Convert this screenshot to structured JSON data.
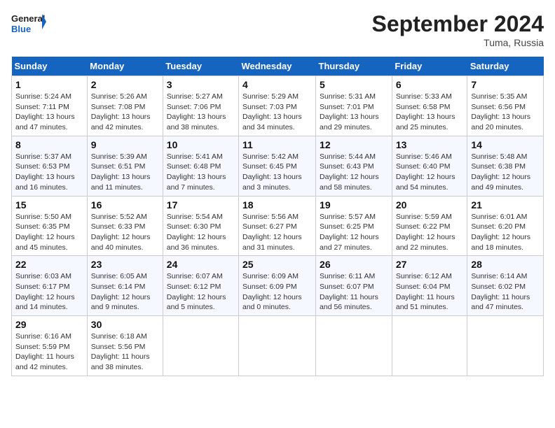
{
  "logo": {
    "line1": "General",
    "line2": "Blue"
  },
  "title": "September 2024",
  "location": "Tuma, Russia",
  "days_of_week": [
    "Sunday",
    "Monday",
    "Tuesday",
    "Wednesday",
    "Thursday",
    "Friday",
    "Saturday"
  ],
  "weeks": [
    [
      {
        "day": 1,
        "rise": "5:24 AM",
        "set": "7:11 PM",
        "hours": "13 hours",
        "mins": "47 minutes"
      },
      {
        "day": 2,
        "rise": "5:26 AM",
        "set": "7:08 PM",
        "hours": "13 hours",
        "mins": "42 minutes"
      },
      {
        "day": 3,
        "rise": "5:27 AM",
        "set": "7:06 PM",
        "hours": "13 hours",
        "mins": "38 minutes"
      },
      {
        "day": 4,
        "rise": "5:29 AM",
        "set": "7:03 PM",
        "hours": "13 hours",
        "mins": "34 minutes"
      },
      {
        "day": 5,
        "rise": "5:31 AM",
        "set": "7:01 PM",
        "hours": "13 hours",
        "mins": "29 minutes"
      },
      {
        "day": 6,
        "rise": "5:33 AM",
        "set": "6:58 PM",
        "hours": "13 hours",
        "mins": "25 minutes"
      },
      {
        "day": 7,
        "rise": "5:35 AM",
        "set": "6:56 PM",
        "hours": "13 hours",
        "mins": "20 minutes"
      }
    ],
    [
      {
        "day": 8,
        "rise": "5:37 AM",
        "set": "6:53 PM",
        "hours": "13 hours",
        "mins": "16 minutes"
      },
      {
        "day": 9,
        "rise": "5:39 AM",
        "set": "6:51 PM",
        "hours": "13 hours",
        "mins": "11 minutes"
      },
      {
        "day": 10,
        "rise": "5:41 AM",
        "set": "6:48 PM",
        "hours": "13 hours",
        "mins": "7 minutes"
      },
      {
        "day": 11,
        "rise": "5:42 AM",
        "set": "6:45 PM",
        "hours": "13 hours",
        "mins": "3 minutes"
      },
      {
        "day": 12,
        "rise": "5:44 AM",
        "set": "6:43 PM",
        "hours": "12 hours",
        "mins": "58 minutes"
      },
      {
        "day": 13,
        "rise": "5:46 AM",
        "set": "6:40 PM",
        "hours": "12 hours",
        "mins": "54 minutes"
      },
      {
        "day": 14,
        "rise": "5:48 AM",
        "set": "6:38 PM",
        "hours": "12 hours",
        "mins": "49 minutes"
      }
    ],
    [
      {
        "day": 15,
        "rise": "5:50 AM",
        "set": "6:35 PM",
        "hours": "12 hours",
        "mins": "45 minutes"
      },
      {
        "day": 16,
        "rise": "5:52 AM",
        "set": "6:33 PM",
        "hours": "12 hours",
        "mins": "40 minutes"
      },
      {
        "day": 17,
        "rise": "5:54 AM",
        "set": "6:30 PM",
        "hours": "12 hours",
        "mins": "36 minutes"
      },
      {
        "day": 18,
        "rise": "5:56 AM",
        "set": "6:27 PM",
        "hours": "12 hours",
        "mins": "31 minutes"
      },
      {
        "day": 19,
        "rise": "5:57 AM",
        "set": "6:25 PM",
        "hours": "12 hours",
        "mins": "27 minutes"
      },
      {
        "day": 20,
        "rise": "5:59 AM",
        "set": "6:22 PM",
        "hours": "12 hours",
        "mins": "22 minutes"
      },
      {
        "day": 21,
        "rise": "6:01 AM",
        "set": "6:20 PM",
        "hours": "12 hours",
        "mins": "18 minutes"
      }
    ],
    [
      {
        "day": 22,
        "rise": "6:03 AM",
        "set": "6:17 PM",
        "hours": "12 hours",
        "mins": "14 minutes"
      },
      {
        "day": 23,
        "rise": "6:05 AM",
        "set": "6:14 PM",
        "hours": "12 hours",
        "mins": "9 minutes"
      },
      {
        "day": 24,
        "rise": "6:07 AM",
        "set": "6:12 PM",
        "hours": "12 hours",
        "mins": "5 minutes"
      },
      {
        "day": 25,
        "rise": "6:09 AM",
        "set": "6:09 PM",
        "hours": "12 hours",
        "mins": "0 minutes"
      },
      {
        "day": 26,
        "rise": "6:11 AM",
        "set": "6:07 PM",
        "hours": "11 hours",
        "mins": "56 minutes"
      },
      {
        "day": 27,
        "rise": "6:12 AM",
        "set": "6:04 PM",
        "hours": "11 hours",
        "mins": "51 minutes"
      },
      {
        "day": 28,
        "rise": "6:14 AM",
        "set": "6:02 PM",
        "hours": "11 hours",
        "mins": "47 minutes"
      }
    ],
    [
      {
        "day": 29,
        "rise": "6:16 AM",
        "set": "5:59 PM",
        "hours": "11 hours",
        "mins": "42 minutes"
      },
      {
        "day": 30,
        "rise": "6:18 AM",
        "set": "5:56 PM",
        "hours": "11 hours",
        "mins": "38 minutes"
      },
      null,
      null,
      null,
      null,
      null
    ]
  ]
}
